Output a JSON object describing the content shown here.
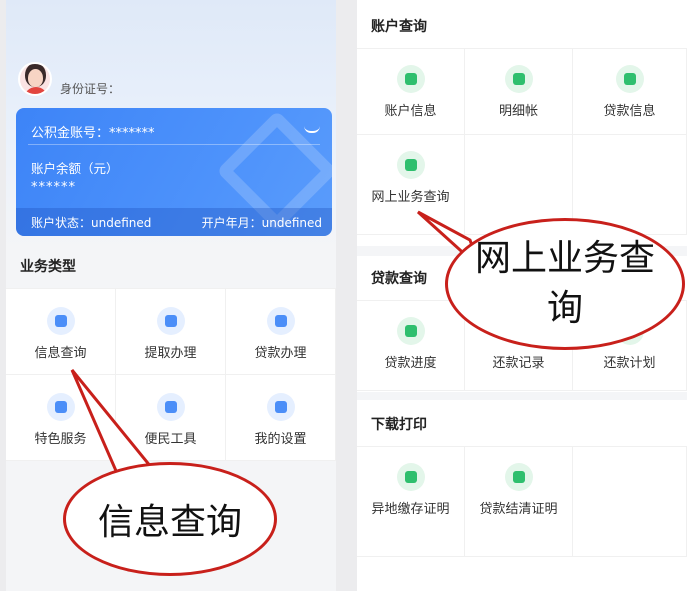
{
  "left": {
    "user": {
      "id_label": "身份证号："
    },
    "card": {
      "account_label": "公积金账号：*******",
      "balance_label": "账户余额（元）",
      "balance_value": "******",
      "status": "账户状态：undefined",
      "open_month": "开户年月：undefined"
    },
    "business_title": "业务类型",
    "business_items": [
      {
        "label": "信息查询",
        "icon": "person-card-icon"
      },
      {
        "label": "提取办理",
        "icon": "document-icon"
      },
      {
        "label": "贷款办理",
        "icon": "loan-icon"
      },
      {
        "label": "特色服务",
        "icon": "star-icon"
      },
      {
        "label": "便民工具",
        "icon": "toolbox-icon"
      },
      {
        "label": "我的设置",
        "icon": "gear-icon"
      }
    ],
    "callout": "信息查询"
  },
  "right": {
    "account_query": {
      "title": "账户查询",
      "items": [
        {
          "label": "账户信息",
          "icon": "account-info-icon"
        },
        {
          "label": "明细帐",
          "icon": "ledger-icon"
        },
        {
          "label": "贷款信息",
          "icon": "loan-info-icon"
        },
        {
          "label": "网上业务查询",
          "icon": "search-icon"
        }
      ]
    },
    "loan_query": {
      "title": "贷款查询",
      "items": [
        {
          "label": "贷款进度",
          "icon": "progress-icon"
        },
        {
          "label": "还款记录",
          "icon": "record-icon"
        },
        {
          "label": "还款计划",
          "icon": "plan-icon"
        }
      ]
    },
    "download_print": {
      "title": "下载打印",
      "items": [
        {
          "label": "异地缴存证明",
          "icon": "location-icon"
        },
        {
          "label": "贷款结清证明",
          "icon": "certificate-icon"
        }
      ]
    },
    "callout": "网上业务查询"
  },
  "colors": {
    "primary": "#4b8ef8",
    "green": "#2fbf6e",
    "callout_border": "#c8201b"
  }
}
